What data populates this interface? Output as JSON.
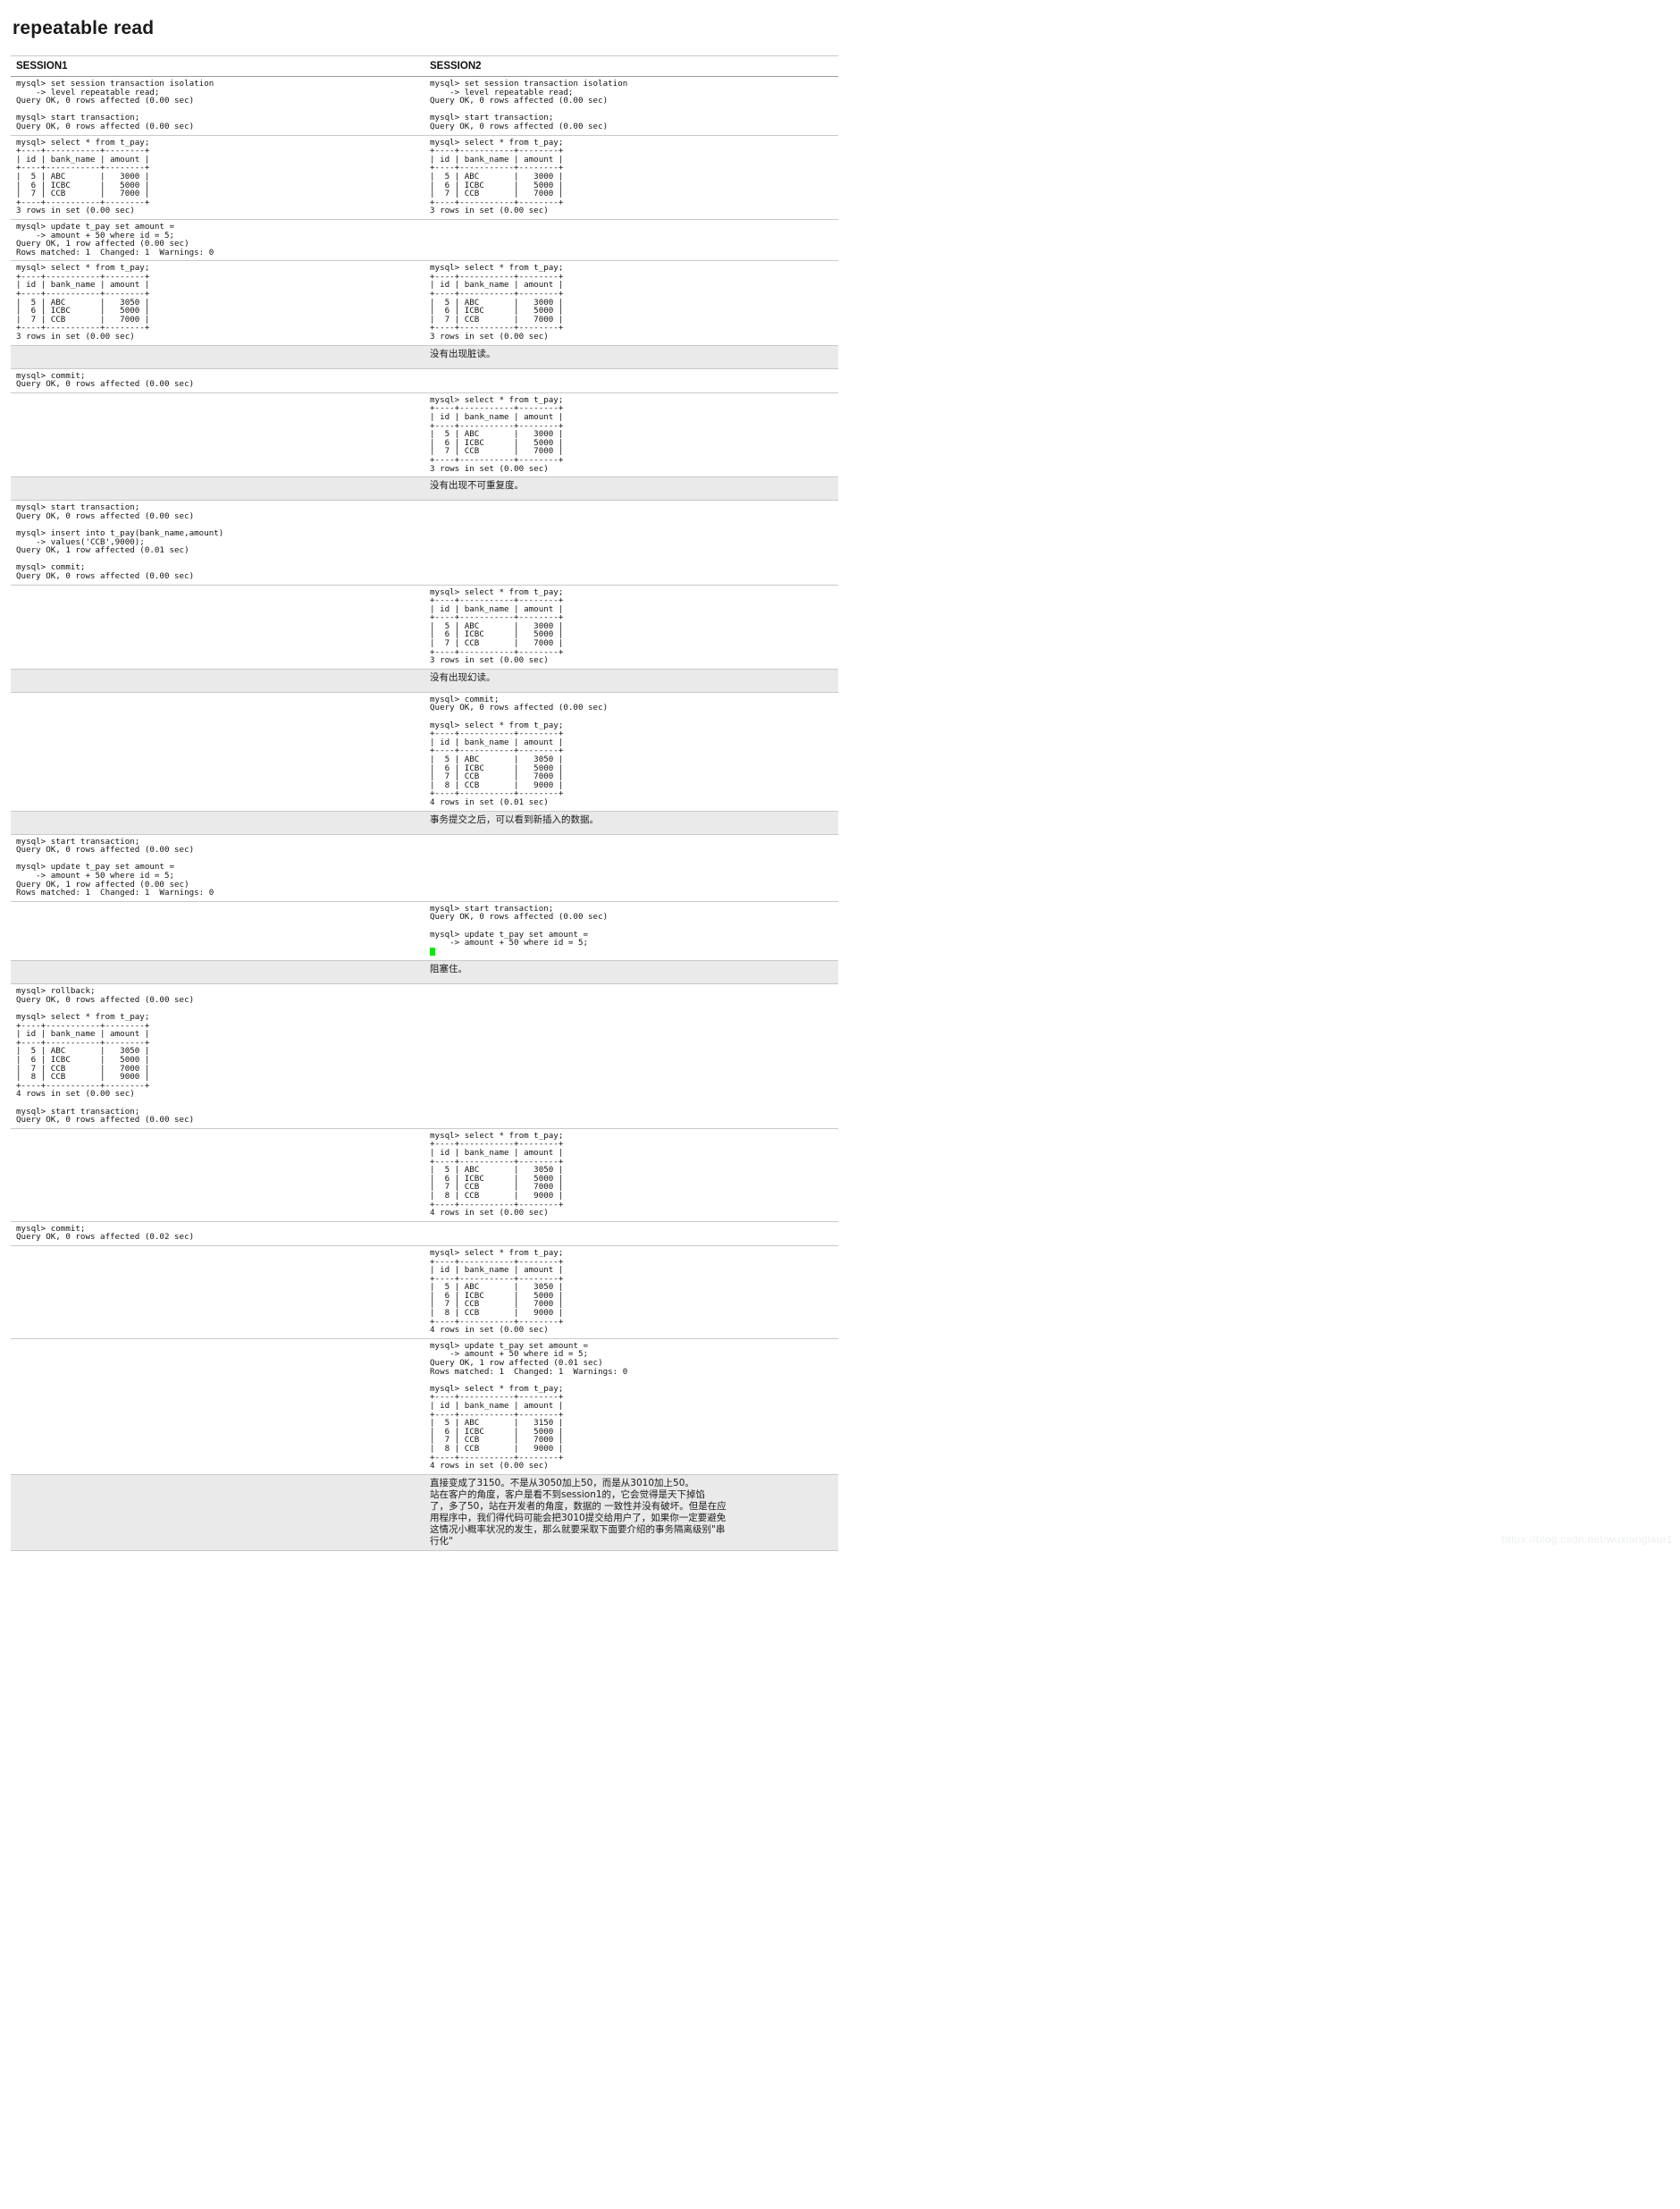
{
  "page": {
    "title": "repeatable read",
    "watermark": "https://blog.csdn.net/wuxianglaur1"
  },
  "table": {
    "headers": {
      "session1": "SESSION1",
      "session2": "SESSION2"
    },
    "rows": [
      {
        "type": "pair",
        "s1": "mysql> set session transaction isolation\n    -> level repeatable read;\nQuery OK, 0 rows affected (0.00 sec)\n\nmysql> start transaction;\nQuery OK, 0 rows affected (0.00 sec)",
        "s1_pad": "shade",
        "s2": "mysql> set session transaction isolation\n    -> level repeatable read;\nQuery OK, 0 rows affected (0.00 sec)\n\nmysql> start transaction;\nQuery OK, 0 rows affected (0.00 sec)",
        "s2_pad": "shade"
      },
      {
        "type": "pair",
        "s1": "mysql> select * from t_pay;\n+----+-----------+--------+\n| id | bank_name | amount |\n+----+-----------+--------+\n|  5 | ABC       |   3000 |\n|  6 | ICBC      |   5000 |\n|  7 | CCB       |   7000 |\n+----+-----------+--------+\n3 rows in set (0.00 sec)",
        "s1_pad": "blank",
        "s2": "mysql> select * from t_pay;\n+----+-----------+--------+\n| id | bank_name | amount |\n+----+-----------+--------+\n|  5 | ABC       |   3000 |\n|  6 | ICBC      |   5000 |\n|  7 | CCB       |   7000 |\n+----+-----------+--------+\n3 rows in set (0.00 sec)",
        "s2_pad": "blank"
      },
      {
        "type": "pair",
        "s1": "mysql> update t_pay set amount =\n    -> amount + 50 where id = 5;\nQuery OK, 1 row affected (0.00 sec)\nRows matched: 1  Changed: 1  Warnings: 0",
        "s1_pad": "shade",
        "s2": "",
        "s2_pad": "shade",
        "s2_empty": true
      },
      {
        "type": "pair",
        "s1": "mysql> select * from t_pay;\n+----+-----------+--------+\n| id | bank_name | amount |\n+----+-----------+--------+\n|  5 | ABC       |   3050 |\n|  6 | ICBC      |   5000 |\n|  7 | CCB       |   7000 |\n+----+-----------+--------+\n3 rows in set (0.00 sec)",
        "s1_pad": "blank",
        "s2": "mysql> select * from t_pay;\n+----+-----------+--------+\n| id | bank_name | amount |\n+----+-----------+--------+\n|  5 | ABC       |   3000 |\n|  6 | ICBC      |   5000 |\n|  7 | CCB       |   7000 |\n+----+-----------+--------+\n3 rows in set (0.00 sec)",
        "s2_pad": "blank"
      },
      {
        "type": "note",
        "side": "s2",
        "text": "没有出现脏读。"
      },
      {
        "type": "pair",
        "s1": "mysql> commit;\nQuery OK, 0 rows affected (0.00 sec)",
        "s1_pad": "blank",
        "s2": "",
        "s2_pad": "blank",
        "s2_empty": true
      },
      {
        "type": "pair",
        "s1": "",
        "s1_empty": true,
        "s1_pad": "shade",
        "s2": "mysql> select * from t_pay;\n+----+-----------+--------+\n| id | bank_name | amount |\n+----+-----------+--------+\n|  5 | ABC       |   3000 |\n|  6 | ICBC      |   5000 |\n|  7 | CCB       |   7000 |\n+----+-----------+--------+\n3 rows in set (0.00 sec)",
        "s2_pad": "shade"
      },
      {
        "type": "note",
        "side": "s2",
        "text": "没有出现不可重复度。"
      },
      {
        "type": "pair",
        "s1": "mysql> start transaction;\nQuery OK, 0 rows affected (0.00 sec)\n\nmysql> insert into t_pay(bank_name,amount)\n    -> values('CCB',9000);\nQuery OK, 1 row affected (0.01 sec)\n\nmysql> commit;\nQuery OK, 0 rows affected (0.00 sec)",
        "s1_pad": "shade",
        "s2": "",
        "s2_empty": true,
        "s2_pad": "shade"
      },
      {
        "type": "pair",
        "s1": "",
        "s1_empty": true,
        "s1_pad": "blank",
        "s2": "mysql> select * from t_pay;\n+----+-----------+--------+\n| id | bank_name | amount |\n+----+-----------+--------+\n|  5 | ABC       |   3000 |\n|  6 | ICBC      |   5000 |\n|  7 | CCB       |   7000 |\n+----+-----------+--------+\n3 rows in set (0.00 sec)",
        "s2_pad": "blank"
      },
      {
        "type": "note",
        "side": "s2",
        "text": "没有出现幻读。"
      },
      {
        "type": "pair",
        "s1": "",
        "s1_empty": true,
        "s1_pad": "blank",
        "s2": "mysql> commit;\nQuery OK, 0 rows affected (0.00 sec)\n\nmysql> select * from t_pay;\n+----+-----------+--------+\n| id | bank_name | amount |\n+----+-----------+--------+\n|  5 | ABC       |   3050 |\n|  6 | ICBC      |   5000 |\n|  7 | CCB       |   7000 |\n|  8 | CCB       |   9000 |\n+----+-----------+--------+\n4 rows in set (0.01 sec)",
        "s2_pad": "blank"
      },
      {
        "type": "note",
        "side": "s2",
        "text": "事务提交之后，可以看到新插入的数据。"
      },
      {
        "type": "pair",
        "s1": "mysql> start transaction;\nQuery OK, 0 rows affected (0.00 sec)\n\nmysql> update t_pay set amount =\n    -> amount + 50 where id = 5;\nQuery OK, 1 row affected (0.00 sec)\nRows matched: 1  Changed: 1  Warnings: 0",
        "s1_pad": "blank",
        "s2": "",
        "s2_empty": true,
        "s2_pad": "blank"
      },
      {
        "type": "pair",
        "s1": "",
        "s1_empty": true,
        "s1_pad": "shade",
        "s2": "mysql> start transaction;\nQuery OK, 0 rows affected (0.00 sec)\n\nmysql> update t_pay set amount =\n    -> amount + 50 where id = 5;",
        "s2_pad": "shade",
        "s2_cursor": true
      },
      {
        "type": "note",
        "side": "s2",
        "text": "阻塞住。"
      },
      {
        "type": "pair",
        "s1": "mysql> rollback;\nQuery OK, 0 rows affected (0.00 sec)\n\nmysql> select * from t_pay;\n+----+-----------+--------+\n| id | bank_name | amount |\n+----+-----------+--------+\n|  5 | ABC       |   3050 |\n|  6 | ICBC      |   5000 |\n|  7 | CCB       |   7000 |\n|  8 | CCB       |   9000 |\n+----+-----------+--------+\n4 rows in set (0.00 sec)\n\nmysql> start transaction;\nQuery OK, 0 rows affected (0.00 sec)",
        "s1_pad": "shade",
        "s2": "",
        "s2_empty": true,
        "s2_pad": "shade"
      },
      {
        "type": "pair",
        "s1": "",
        "s1_empty": true,
        "s1_pad": "blank",
        "s2": "mysql> select * from t_pay;\n+----+-----------+--------+\n| id | bank_name | amount |\n+----+-----------+--------+\n|  5 | ABC       |   3050 |\n|  6 | ICBC      |   5000 |\n|  7 | CCB       |   7000 |\n|  8 | CCB       |   9000 |\n+----+-----------+--------+\n4 rows in set (0.00 sec)",
        "s2_pad": "blank"
      },
      {
        "type": "pair",
        "s1": "mysql> commit;\nQuery OK, 0 rows affected (0.02 sec)",
        "s1_pad": "shade",
        "s2": "",
        "s2_empty": true,
        "s2_pad": "shade"
      },
      {
        "type": "pair",
        "s1": "",
        "s1_empty": true,
        "s1_pad": "blank",
        "s2": "mysql> select * from t_pay;\n+----+-----------+--------+\n| id | bank_name | amount |\n+----+-----------+--------+\n|  5 | ABC       |   3050 |\n|  6 | ICBC      |   5000 |\n|  7 | CCB       |   7000 |\n|  8 | CCB       |   9000 |\n+----+-----------+--------+\n4 rows in set (0.00 sec)",
        "s2_pad": "blank"
      },
      {
        "type": "pair",
        "s1": "",
        "s1_empty": true,
        "s1_pad": "shade",
        "s2": "mysql> update t_pay set amount =\n    -> amount + 50 where id = 5;\nQuery OK, 1 row affected (0.01 sec)\nRows matched: 1  Changed: 1  Warnings: 0\n\nmysql> select * from t_pay;\n+----+-----------+--------+\n| id | bank_name | amount |\n+----+-----------+--------+\n|  5 | ABC       |   3150 |\n|  6 | ICBC      |   5000 |\n|  7 | CCB       |   7000 |\n|  8 | CCB       |   9000 |\n+----+-----------+--------+\n4 rows in set (0.00 sec)",
        "s2_pad": "shade"
      },
      {
        "type": "note",
        "side": "s2",
        "text": "直接变成了3150。不是从3050加上50，而是从3010加上50。\n站在客户的角度，客户是看不到session1的，它会觉得是天下掉馅\n了，多了50，站在开发者的角度，数据的 一致性并没有破坏。但是在应\n用程序中，我们得代码可能会把3010提交给用户了，如果你一定要避免\n这情况小概率状况的发生，那么就要采取下面要介绍的事务隔离级别\"串\n行化\""
      }
    ]
  }
}
